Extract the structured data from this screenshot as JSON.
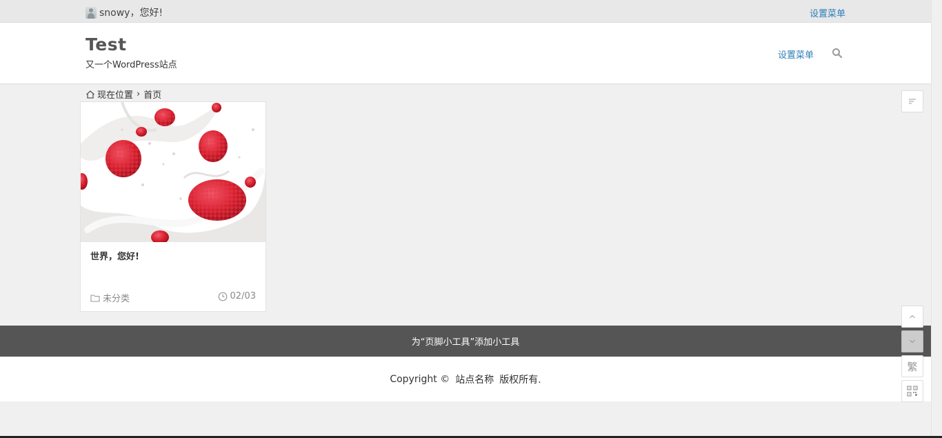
{
  "topbar": {
    "greeting": "snowy，您好!",
    "menu_label": "设置菜单"
  },
  "header": {
    "site_title": "Test",
    "site_description": "又一个WordPress站点",
    "menu_label": "设置菜单",
    "search_icon": "search-icon"
  },
  "breadcrumb": {
    "prefix": "现在位置",
    "separator": "›",
    "current": "首页"
  },
  "post": {
    "title": "世界，您好!",
    "category": "未分类",
    "date": "02/03"
  },
  "footer": {
    "widget_hint": "为“页脚小工具”添加小工具",
    "copyright": "Copyright ©",
    "site_name": "站点名称",
    "rights": "版权所有."
  },
  "side_tools": {
    "traditional_label": "繁"
  },
  "colors": {
    "accent": "#2e7fb8",
    "footer_bg": "#555555",
    "page_bg": "#f0f0f0"
  }
}
